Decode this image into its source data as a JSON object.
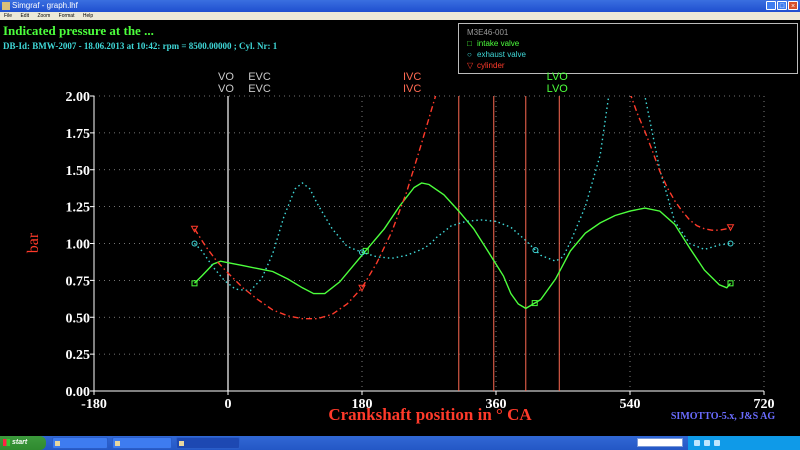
{
  "window": {
    "title": "Simgraf - graph.lhf"
  },
  "menu": [
    "File",
    "Edit",
    "Zoom",
    "Format",
    "Help"
  ],
  "header": {
    "title": "Indicated pressure at the ...",
    "dbid": "DB-Id: BMW-2007 - 18.06.2013 at 10:42: rpm = 8500.00000 ; Cyl. Nr: 1"
  },
  "legend": {
    "header": "M3E46-001",
    "items": [
      {
        "symbol": "□",
        "label": "intake valve",
        "color": "#4cff3c"
      },
      {
        "symbol": "○",
        "label": "exhaust valve",
        "color": "#3fd8d8"
      },
      {
        "symbol": "▽",
        "label": "cylinder",
        "color": "#ff3a2a"
      }
    ]
  },
  "credit": "SIMOTTO-5.x, J&S AG",
  "colors": {
    "intake": "#4cff3c",
    "exhaust": "#3fd8d8",
    "cylinder": "#ff3a2a",
    "marker": "#ff6a52",
    "gray": "#c9c9c9",
    "grid": "#9a9a9a"
  },
  "chart_data": {
    "type": "line",
    "xlabel": "Crankshaft position in ° CA",
    "ylabel": "bar",
    "xlim": [
      -180,
      720
    ],
    "ylim": [
      0,
      2
    ],
    "xticks": [
      "-180",
      "0",
      "180",
      "360",
      "540",
      "720"
    ],
    "yticks": [
      "0.00",
      "0.25",
      "0.50",
      "0.75",
      "1.00",
      "1.25",
      "1.50",
      "1.75",
      "2.00"
    ],
    "grid": true,
    "events": [
      {
        "label": "VO",
        "x": 0,
        "color": "#c9c9c9"
      },
      {
        "label": "EVC",
        "x": 45,
        "color": "#c9c9c9"
      },
      {
        "label": "IVC",
        "x": 250,
        "color": "#ff6a52"
      },
      {
        "label": "LVO",
        "x": 445,
        "color": "#4cff3c"
      }
    ],
    "extra_lines": [
      {
        "x": 310,
        "color": "#ff6a52"
      },
      {
        "x": 357,
        "color": "#ff6a52"
      },
      {
        "x": 400,
        "color": "#ff6a52"
      },
      {
        "x": 445,
        "color": "#ff6a52"
      }
    ],
    "series": [
      {
        "key": "intake",
        "name": "intake valve",
        "style": "solid",
        "marker": "square",
        "x": [
          -45,
          -35,
          -20,
          -10,
          0,
          20,
          40,
          60,
          80,
          100,
          115,
          130,
          150,
          170,
          190,
          210,
          230,
          250,
          260,
          270,
          290,
          310,
          330,
          350,
          370,
          380,
          390,
          400,
          420,
          440,
          460,
          480,
          500,
          520,
          540,
          560,
          580,
          600,
          620,
          640,
          660,
          670,
          675
        ],
        "y": [
          0.73,
          0.78,
          0.86,
          0.88,
          0.87,
          0.85,
          0.83,
          0.81,
          0.76,
          0.7,
          0.66,
          0.66,
          0.74,
          0.86,
          0.98,
          1.1,
          1.25,
          1.38,
          1.41,
          1.4,
          1.33,
          1.22,
          1.1,
          0.94,
          0.78,
          0.66,
          0.59,
          0.56,
          0.62,
          0.76,
          0.95,
          1.07,
          1.14,
          1.19,
          1.22,
          1.24,
          1.22,
          1.13,
          0.97,
          0.82,
          0.72,
          0.7,
          0.73
        ],
        "marker_x": [
          -45,
          185,
          412,
          675
        ]
      },
      {
        "key": "exhaust",
        "name": "exhaust valve",
        "style": "dotted",
        "marker": "circle",
        "x": [
          -45,
          -35,
          -20,
          -5,
          10,
          30,
          45,
          60,
          75,
          90,
          100,
          110,
          120,
          140,
          160,
          180,
          200,
          220,
          240,
          260,
          270,
          280,
          290,
          300,
          320,
          340,
          360,
          380,
          400,
          420,
          440,
          450,
          460,
          480,
          500,
          520,
          540,
          560,
          580,
          600,
          620,
          640,
          660,
          675
        ],
        "y": [
          1.0,
          0.95,
          0.84,
          0.75,
          0.69,
          0.68,
          0.76,
          0.93,
          1.18,
          1.37,
          1.41,
          1.37,
          1.27,
          1.1,
          0.98,
          0.94,
          0.91,
          0.9,
          0.92,
          0.96,
          0.99,
          1.04,
          1.08,
          1.12,
          1.15,
          1.16,
          1.15,
          1.11,
          1.02,
          0.92,
          0.88,
          0.91,
          1.01,
          1.25,
          1.6,
          2.3,
          2.3,
          2.0,
          1.5,
          1.15,
          1.0,
          0.96,
          0.99,
          1.0
        ],
        "marker_x": [
          -45,
          180,
          413,
          675
        ]
      },
      {
        "key": "cylinder",
        "name": "cylinder",
        "style": "dashdot",
        "marker": "triangle",
        "x": [
          -45,
          -30,
          -15,
          0,
          20,
          40,
          60,
          80,
          100,
          120,
          140,
          160,
          180,
          200,
          220,
          240,
          260,
          270,
          280,
          290
        ],
        "y": [
          1.1,
          0.98,
          0.88,
          0.8,
          0.7,
          0.62,
          0.55,
          0.51,
          0.49,
          0.49,
          0.52,
          0.59,
          0.7,
          0.87,
          1.08,
          1.35,
          1.68,
          1.85,
          2.02,
          2.4
        ],
        "x2": [
          530,
          540,
          550,
          560,
          570,
          580,
          590,
          600,
          610,
          620,
          630,
          640,
          650,
          660,
          670,
          675
        ],
        "y2": [
          2.2,
          2.02,
          1.88,
          1.76,
          1.63,
          1.49,
          1.38,
          1.29,
          1.22,
          1.16,
          1.12,
          1.1,
          1.09,
          1.09,
          1.1,
          1.11
        ],
        "marker_x": [
          -45,
          180,
          675
        ]
      }
    ]
  }
}
